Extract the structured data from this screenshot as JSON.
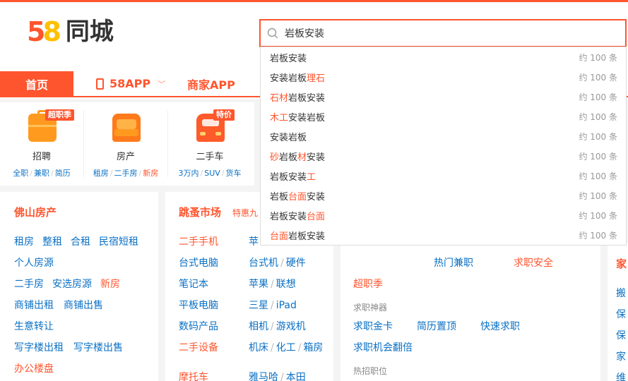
{
  "logo": {
    "digit5": "5",
    "digit8": "8",
    "text": "同城"
  },
  "search": {
    "value": "岩板安装"
  },
  "suggestions": [
    {
      "parts": [
        {
          "t": "岩板安装",
          "h": false
        }
      ],
      "count": "约 100 条"
    },
    {
      "parts": [
        {
          "t": "安装岩板",
          "h": false
        },
        {
          "t": "理石",
          "h": true
        }
      ],
      "count": "约 100 条"
    },
    {
      "parts": [
        {
          "t": "石材",
          "h": true
        },
        {
          "t": "岩板安装",
          "h": false
        }
      ],
      "count": "约 100 条"
    },
    {
      "parts": [
        {
          "t": "木工",
          "h": true
        },
        {
          "t": "安装岩板",
          "h": false
        }
      ],
      "count": "约 100 条"
    },
    {
      "parts": [
        {
          "t": "安装岩板",
          "h": false
        }
      ],
      "count": "约 100 条"
    },
    {
      "parts": [
        {
          "t": "砂",
          "h": true
        },
        {
          "t": "岩板",
          "h": false
        },
        {
          "t": "材",
          "h": true
        },
        {
          "t": "安装",
          "h": false
        }
      ],
      "count": "约 100 条"
    },
    {
      "parts": [
        {
          "t": "岩板安装",
          "h": false
        },
        {
          "t": "工",
          "h": true
        }
      ],
      "count": "约 100 条"
    },
    {
      "parts": [
        {
          "t": "岩板",
          "h": false
        },
        {
          "t": "台面",
          "h": true
        },
        {
          "t": "安装",
          "h": false
        }
      ],
      "count": "约 100 条"
    },
    {
      "parts": [
        {
          "t": "岩板安装",
          "h": false
        },
        {
          "t": "台面",
          "h": true
        }
      ],
      "count": "约 100 条"
    },
    {
      "parts": [
        {
          "t": "台面",
          "h": true
        },
        {
          "t": "岩板安装",
          "h": false
        }
      ],
      "count": "约 100 条"
    }
  ],
  "nav": {
    "home": "首页",
    "app": "58APP",
    "merchant": "商家APP"
  },
  "quick": [
    {
      "label": "招聘",
      "badge": "超职季",
      "subs": [
        {
          "t": "全职",
          "red": false
        },
        {
          "t": "兼职",
          "red": false
        },
        {
          "t": "简历",
          "red": false
        }
      ]
    },
    {
      "label": "房产",
      "badge": "",
      "subs": [
        {
          "t": "租房",
          "red": false
        },
        {
          "t": "二手房",
          "red": false
        },
        {
          "t": "新房",
          "red": true
        }
      ]
    },
    {
      "label": "二手车",
      "badge": "特价",
      "subs": [
        {
          "t": "3万内",
          "red": false
        },
        {
          "t": "SUV",
          "red": false
        },
        {
          "t": "货车",
          "red": false
        }
      ]
    }
  ],
  "house": {
    "title": "佛山房产",
    "rows": [
      [
        {
          "t": "租房"
        },
        {
          "t": "整租"
        },
        {
          "t": "合租"
        },
        {
          "t": "民宿短租"
        }
      ],
      [
        {
          "t": "个人房源"
        }
      ],
      [
        {
          "t": "二手房"
        },
        {
          "t": "安选房源"
        },
        {
          "t": "新房",
          "red": true
        }
      ],
      [
        {
          "t": "商铺出租"
        },
        {
          "t": "商铺出售"
        }
      ],
      [
        {
          "t": "生意转让"
        }
      ],
      [
        {
          "t": "写字楼出租"
        },
        {
          "t": "写字楼出售"
        }
      ],
      [
        {
          "t": "办公楼盘",
          "red": true
        }
      ]
    ]
  },
  "market": {
    "title": "跳蚤市场",
    "subtitle": "特惠九",
    "col1": [
      {
        "t": "二手手机",
        "red": true
      },
      {
        "t": "台式电脑"
      },
      {
        "t": "笔记本"
      },
      {
        "t": "平板电脑"
      },
      {
        "t": "数码产品"
      },
      {
        "t": "二手设备",
        "red": true
      },
      {
        "t": "摩托车",
        "red": true
      }
    ],
    "col2": [
      [
        "苹"
      ],
      [
        "台式机",
        "硬件"
      ],
      [
        "苹果",
        "联想"
      ],
      [
        "三星",
        "iPad"
      ],
      [
        "相机",
        "游戏机"
      ],
      [
        "机床",
        "化工",
        "箱房"
      ],
      [
        "雅马哈",
        "本田"
      ]
    ]
  },
  "jobs": {
    "hot_part_time": "热门兼职",
    "job_safety": "求职安全",
    "season": "超职季",
    "tools_title": "求职神器",
    "tools": [
      "求职金卡",
      "简历置顶",
      "快速求职"
    ],
    "flip": "求职机会翻倍",
    "hot_positions": "热招职位"
  },
  "home_service": {
    "title": "家",
    "items": [
      "搬",
      "保",
      "保",
      "家",
      "维"
    ]
  }
}
